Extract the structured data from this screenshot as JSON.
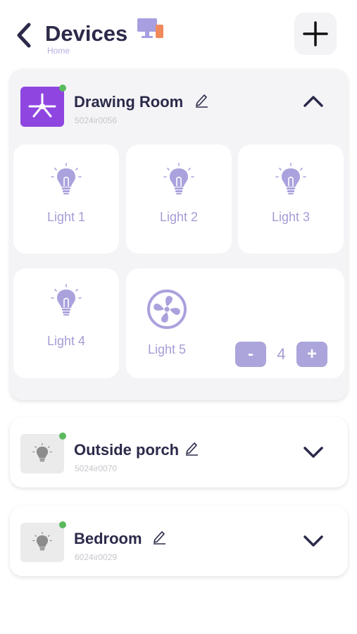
{
  "header": {
    "title": "Devices",
    "subtitle": "Home",
    "back_icon": "chevron-left-icon",
    "add_icon": "plus-icon",
    "title_icon": "devices-icon"
  },
  "rooms": [
    {
      "name": "Drawing Room",
      "id": "5024ir0056",
      "expanded": true,
      "online": true,
      "icon": "ceiling-fan-icon",
      "devices": [
        {
          "label": "Light 1",
          "icon": "bulb-icon"
        },
        {
          "label": "Light 2",
          "icon": "bulb-icon"
        },
        {
          "label": "Light 3",
          "icon": "bulb-icon"
        },
        {
          "label": "Light 4",
          "icon": "bulb-icon"
        },
        {
          "label": "Light 5",
          "icon": "fan-icon",
          "stepper": {
            "minus": "-",
            "value": "4",
            "plus": "+"
          }
        }
      ]
    },
    {
      "name": "Outside porch",
      "id": "5024ir0070",
      "expanded": false,
      "online": true,
      "icon": "bulb-icon"
    },
    {
      "name": "Bedroom",
      "id": "6024ir0029",
      "expanded": false,
      "online": true,
      "icon": "bulb-icon"
    }
  ],
  "colors": {
    "accent": "#8f46e0",
    "device": "#a59dd5",
    "online": "#5aba5e",
    "text": "#2b2a4a"
  }
}
